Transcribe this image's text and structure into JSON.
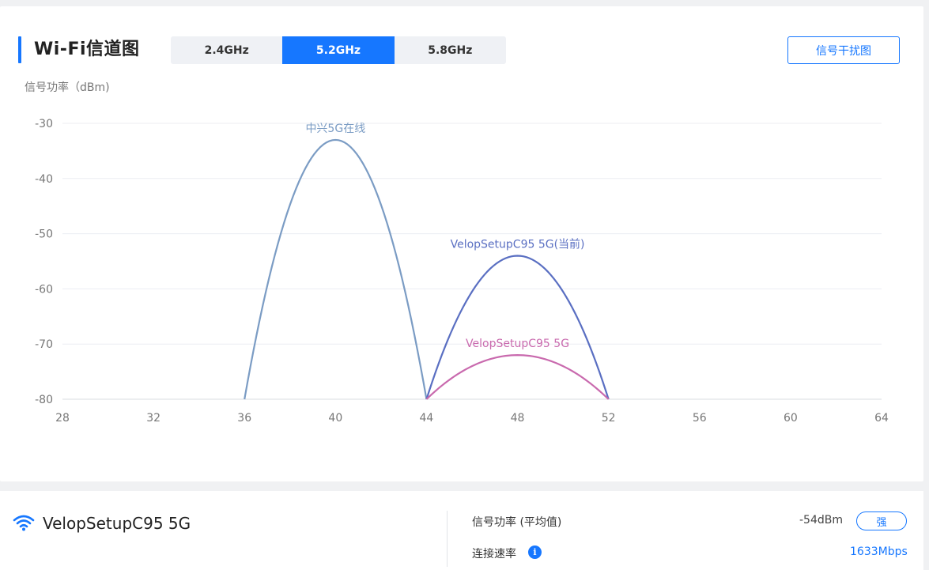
{
  "header": {
    "title": "Wi-Fi信道图",
    "tabs": [
      {
        "label": "2.4GHz",
        "active": false
      },
      {
        "label": "5.2GHz",
        "active": true
      },
      {
        "label": "5.8GHz",
        "active": false
      }
    ],
    "interference_button": "信号干扰图"
  },
  "chart_data": {
    "type": "area",
    "ylabel": "信号功率（dBm)",
    "xlim": [
      28,
      64
    ],
    "ylim": [
      -80,
      -30
    ],
    "x_ticks": [
      "28",
      "32",
      "36",
      "40",
      "44",
      "48",
      "52",
      "56",
      "60",
      "64"
    ],
    "y_ticks": [
      "-30",
      "-40",
      "-50",
      "-60",
      "-70",
      "-80"
    ],
    "grid": true,
    "series": [
      {
        "name": "中兴5G在线",
        "start": 36,
        "center": 40,
        "end": 44,
        "peak": -33,
        "color": "#7b9cc4"
      },
      {
        "name": "VelopSetupC95 5G(当前)",
        "start": 44,
        "center": 48,
        "end": 52,
        "peak": -54,
        "color": "#5a6fc2"
      },
      {
        "name": "VelopSetupC95 5G",
        "start": 44,
        "center": 48,
        "end": 52,
        "peak": -72,
        "color": "#c96aae"
      }
    ]
  },
  "network": {
    "ssid": "VelopSetupC95 5G",
    "signal_label": "信号功率 (平均值)",
    "signal_value": "-54dBm",
    "signal_badge": "强",
    "rate_label": "连接速率",
    "rate_value": "1633Mbps",
    "info_icon": "info-icon"
  },
  "colors": {
    "accent": "#1677ff"
  }
}
